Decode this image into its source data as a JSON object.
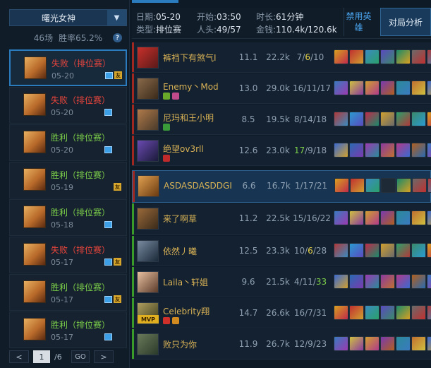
{
  "hero_selector": {
    "name": "曙光女神",
    "chevron": "chevron-down-icon"
  },
  "summary": {
    "games": "46场",
    "winrate": "胜率65.2%",
    "help": "?"
  },
  "matches": [
    {
      "result": "失败（排位赛）",
      "date": "05-20",
      "outcome": "lose",
      "screenshot": true,
      "mvp": true,
      "selected": true
    },
    {
      "result": "失败（排位赛）",
      "date": "05-20",
      "outcome": "lose",
      "screenshot": true,
      "mvp": false
    },
    {
      "result": "胜利（排位赛）",
      "date": "05-20",
      "outcome": "win",
      "screenshot": true,
      "mvp": false
    },
    {
      "result": "胜利（排位赛）",
      "date": "05-19",
      "outcome": "win",
      "screenshot": false,
      "mvp": true
    },
    {
      "result": "胜利（排位赛）",
      "date": "05-18",
      "outcome": "win",
      "screenshot": true,
      "mvp": false
    },
    {
      "result": "失败（排位赛）",
      "date": "05-17",
      "outcome": "lose",
      "screenshot": true,
      "mvp": true
    },
    {
      "result": "胜利（排位赛）",
      "date": "05-17",
      "outcome": "win",
      "screenshot": true,
      "mvp": true
    },
    {
      "result": "胜利（排位赛）",
      "date": "05-17",
      "outcome": "win",
      "screenshot": true,
      "mvp": false
    }
  ],
  "pager": {
    "prev": "<",
    "page": "1",
    "total": "/6",
    "go": "GO",
    "next": ">"
  },
  "header": {
    "date_label": "日期:",
    "date_value": "05-20",
    "start_label": "开始:",
    "start_value": "03:50",
    "duration_label": "时长:",
    "duration_value": "61分钟",
    "type_label": "类型:",
    "type_value": "排位赛",
    "heads_label": "人头:",
    "heads_value": "49/57",
    "gold_label": "金钱:",
    "gold_value": "110.4k/120.6k",
    "ban_button": "禁用英雄",
    "analysis_button": "对局分析"
  },
  "players": [
    {
      "name": "裤裆下有煞气I",
      "kda_score": "11.1",
      "gold": "22.2k",
      "kills": "7",
      "deaths": "6",
      "assists": "10",
      "team": "red",
      "deaths_hl": true
    },
    {
      "name": "Enemy丶Mod",
      "kda_score": "13.0",
      "gold": "29.0k",
      "kills": "16",
      "deaths": "11",
      "assists": "17",
      "team": "red",
      "gold_hl": true
    },
    {
      "name": "尼玛和王小明",
      "kda_score": "8.5",
      "gold": "19.5k",
      "kills": "8",
      "deaths": "14",
      "assists": "18",
      "team": "red"
    },
    {
      "name": "绝望ov3rll",
      "kda_score": "12.6",
      "gold": "23.0k",
      "kills": "17",
      "deaths": "9",
      "assists": "18",
      "team": "red",
      "kills_hl": true
    },
    {
      "name": "ASDASDASDDGI",
      "kda_score": "6.6",
      "gold": "16.7k",
      "kills": "1",
      "deaths": "17",
      "assists": "21",
      "team": "red",
      "me": true
    },
    {
      "name": "来了啊草",
      "kda_score": "11.2",
      "gold": "22.5k",
      "kills": "15",
      "deaths": "16",
      "assists": "22",
      "team": "green"
    },
    {
      "name": "依然丿曦",
      "kda_score": "12.5",
      "gold": "23.3k",
      "kills": "10",
      "deaths": "6",
      "assists": "28",
      "team": "green",
      "deaths_hl": true
    },
    {
      "name": "Laila丶轩姐",
      "kda_score": "9.6",
      "gold": "21.5k",
      "kills": "4",
      "deaths": "11",
      "assists": "33",
      "team": "green",
      "assists_hl": true
    },
    {
      "name": "Celebrity翔",
      "kda_score": "14.7",
      "gold": "26.6k",
      "kills": "16",
      "deaths": "7",
      "assists": "31",
      "team": "green",
      "mvp": true,
      "score_hl": true
    },
    {
      "name": "败只为你",
      "kda_score": "11.9",
      "gold": "26.7k",
      "kills": "12",
      "deaths": "9",
      "assists": "23",
      "team": "green"
    }
  ],
  "colors": {
    "win": "#7ccf4a",
    "lose": "#e8453c",
    "accent": "#2b7bbf",
    "name": "#d8b255",
    "highlight_yellow": "#e6d24a"
  }
}
